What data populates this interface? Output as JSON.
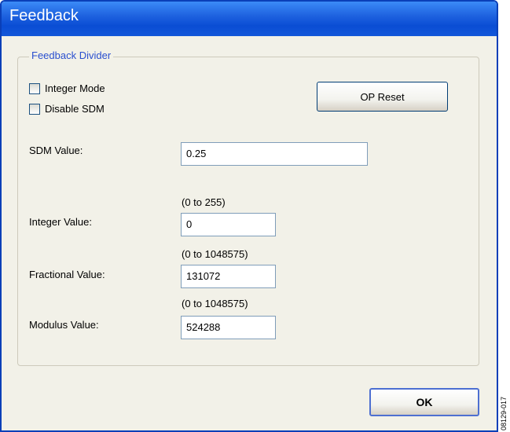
{
  "window": {
    "title": "Feedback"
  },
  "group": {
    "title": "Feedback Divider",
    "integer_mode": {
      "label": "Integer Mode",
      "checked": false
    },
    "disable_sdm": {
      "label": "Disable SDM",
      "checked": false
    },
    "op_reset_label": "OP Reset",
    "sdm": {
      "label": "SDM Value:",
      "value": "0.25"
    },
    "integer": {
      "label": "Integer Value:",
      "range": "(0 to 255)",
      "value": "0"
    },
    "fractional": {
      "label": "Fractional Value:",
      "range": "(0 to 1048575)",
      "value": "131072"
    },
    "modulus": {
      "label": "Modulus Value:",
      "range": "(0 to 1048575)",
      "value": "524288"
    }
  },
  "ok_label": "OK",
  "figure_id": "08129-017"
}
